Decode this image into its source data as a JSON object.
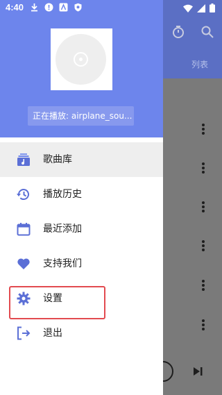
{
  "status_bar": {
    "time": "4:40",
    "left_icons": [
      "download-icon",
      "alert-icon",
      "text-app-icon",
      "shield-icon"
    ],
    "right_icons": [
      "wifi-icon",
      "signal-icon",
      "battery-icon"
    ]
  },
  "background_app": {
    "tab_label": "列表",
    "header_icons": [
      "timer-icon",
      "search-icon"
    ],
    "controls": [
      "play-icon",
      "skip-next-icon"
    ]
  },
  "drawer": {
    "now_playing": "正在播放: airplane_sou...",
    "items": [
      {
        "label": "歌曲库",
        "icon": "library-icon",
        "active": true
      },
      {
        "label": "播放历史",
        "icon": "history-icon",
        "active": false
      },
      {
        "label": "最近添加",
        "icon": "calendar-icon",
        "active": false
      },
      {
        "label": "支持我们",
        "icon": "heart-icon",
        "active": false
      },
      {
        "label": "设置",
        "icon": "gear-icon",
        "active": false
      },
      {
        "label": "退出",
        "icon": "exit-icon",
        "active": false
      }
    ]
  },
  "colors": {
    "drawer_header": "#6d85ec",
    "accent_icon": "#5b6fd6",
    "highlight": "#e24a4f"
  }
}
